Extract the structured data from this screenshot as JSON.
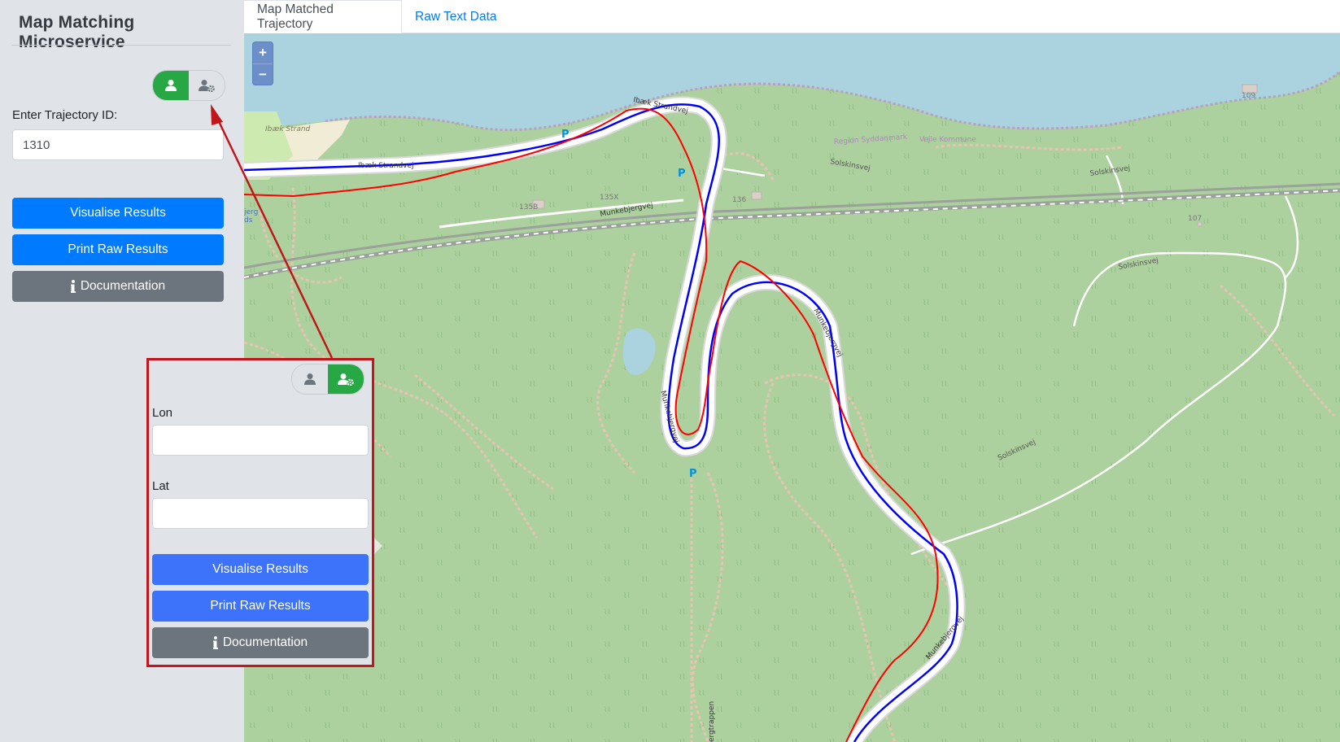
{
  "app": {
    "title": "Map Matching Microservice"
  },
  "tabs": [
    {
      "label": "Map Matched Trajectory",
      "active": true
    },
    {
      "label": "Raw Text Data",
      "active": false
    }
  ],
  "form": {
    "trajectory_label": "Enter Trajectory ID:",
    "trajectory_value": "1310",
    "mode": "trajectory"
  },
  "buttons": {
    "visualise": "Visualise Results",
    "print_raw": "Print Raw Results",
    "documentation": "Documentation"
  },
  "inset_form": {
    "lon_label": "Lon",
    "lon_value": "",
    "lat_label": "Lat",
    "lat_value": "",
    "mode": "coordinates",
    "visualise": "Visualise Results",
    "print_raw": "Print Raw Results",
    "documentation": "Documentation"
  },
  "map": {
    "zoom_in": "+",
    "zoom_out": "−",
    "labels": {
      "ibaek_strand": "Ibæk Strand",
      "ibaek_strandvej_1": "Ibæk Strandvej",
      "ibaek_strandvej_2": "Ibæk Strandvej",
      "munkebjergvej_1": "Munkebjergvej",
      "munkebjergvej_2": "Munkebjergvej",
      "munkebjergvej_3": "Munkebjergvej",
      "munkebjergvej_4": "Munkebjergvej",
      "solskinsvej_1": "Solskinsvej",
      "solskinsvej_2": "Solskinsvej",
      "solskinsvej_3": "Solskinsvej",
      "solskinsvej_4": "Solskinsvej",
      "region": "Region Syddanmark",
      "kommune": "Vejle Kommune",
      "trappen": "ergtrappen",
      "erg": "jerg",
      "ds": "ds",
      "parking": "P",
      "house_135b": "135B",
      "house_135x": "135X",
      "house_136": "136",
      "house_107": "107",
      "house_109": "109"
    },
    "colors": {
      "water": "#aad3df",
      "forest": "#add19e",
      "road": "#ffffff",
      "matched_route": "#0000ff",
      "raw_trajectory": "#ff0000",
      "annotation": "#c0161c"
    }
  },
  "icons": {
    "user": "user-icon",
    "user_cog": "user-cog-icon",
    "info": "info-icon"
  }
}
